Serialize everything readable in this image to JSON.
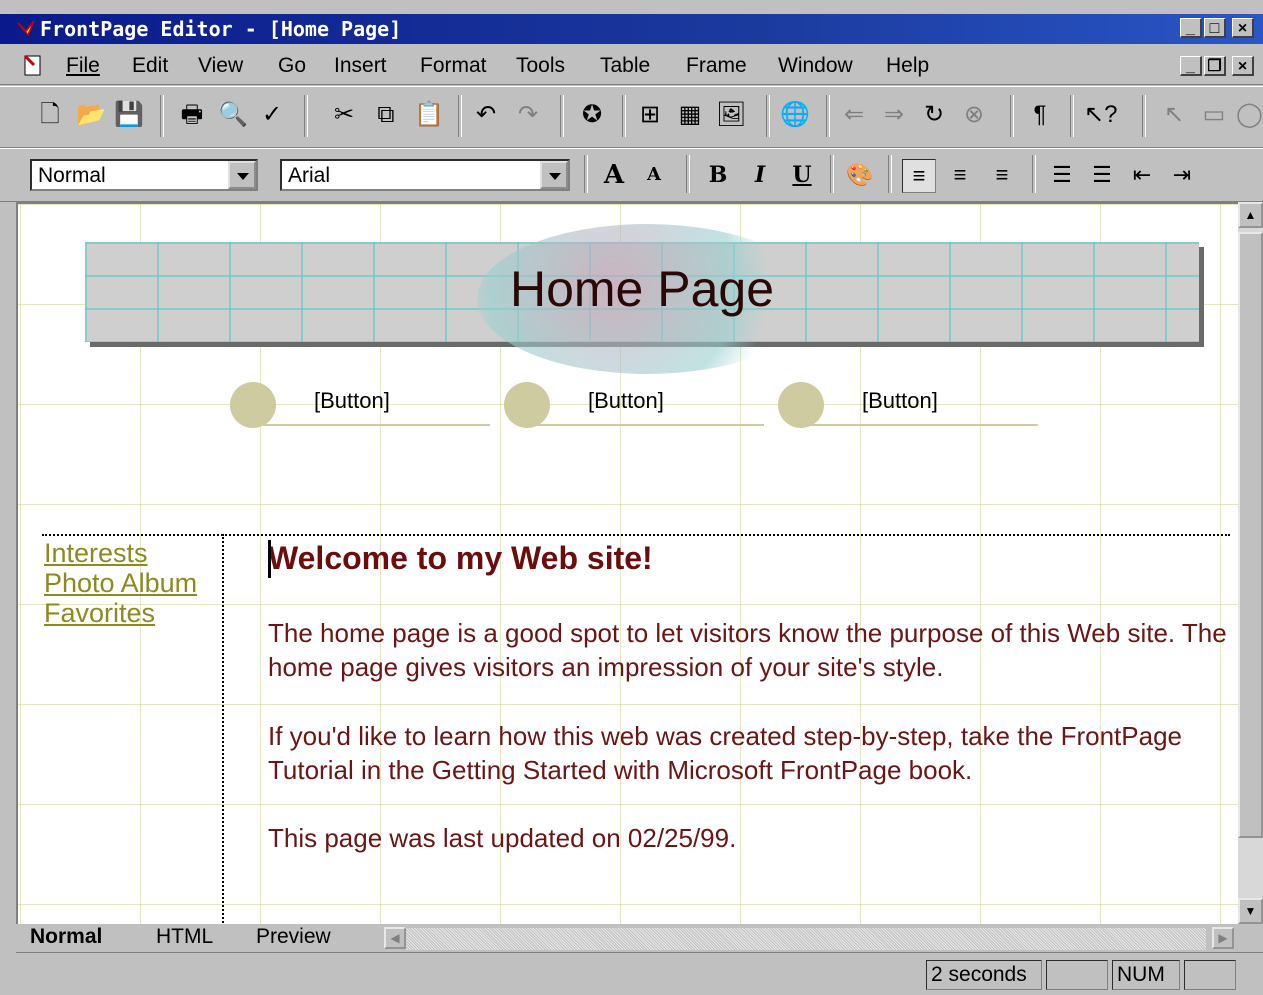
{
  "titlebar": {
    "title": "FrontPage Editor - [Home Page]",
    "buttons": [
      "minimize",
      "maximize",
      "close"
    ]
  },
  "menubar": {
    "items": [
      "File",
      "Edit",
      "View",
      "Go",
      "Insert",
      "Format",
      "Tools",
      "Table",
      "Frame",
      "Window",
      "Help"
    ]
  },
  "toolbar_standard": {
    "icons": [
      "new-icon",
      "open-icon",
      "save-icon",
      "print-icon",
      "print-preview-icon",
      "spelling-icon",
      "cut-icon",
      "copy-icon",
      "paste-icon",
      "undo-icon",
      "redo-icon",
      "webbot-icon",
      "table-icon",
      "insert-table-icon",
      "image-icon",
      "hyperlink-icon",
      "back-icon",
      "forward-icon",
      "refresh-icon",
      "stop-icon",
      "paragraph-marks-icon",
      "help-icon",
      "pointer-icon",
      "rectangle-icon"
    ]
  },
  "toolbar_format": {
    "style_value": "Normal",
    "font_value": "Arial",
    "buttons": [
      "increase-font-icon",
      "decrease-font-icon",
      "bold-icon",
      "italic-icon",
      "underline-icon",
      "text-color-icon",
      "align-left-icon",
      "align-center-icon",
      "align-right-icon",
      "numbered-list-icon",
      "bulleted-list-icon",
      "decrease-indent-icon",
      "increase-indent-icon"
    ]
  },
  "page": {
    "banner_title": "Home Page",
    "nav_buttons": [
      "[Button]",
      "[Button]",
      "[Button]"
    ],
    "side_links": [
      "Interests",
      "Photo Album",
      "Favorites"
    ],
    "heading": "Welcome to my Web site!",
    "paragraphs": [
      "The home page is a good spot to let visitors know the purpose of this Web site. The home page gives visitors an impression of your site's style.",
      "If you'd like to learn how this web was created step-by-step, take the FrontPage Tutorial in the Getting Started with Microsoft FrontPage book.",
      "This page was last updated on 02/25/99."
    ]
  },
  "tabs": [
    "Normal",
    "HTML",
    "Preview"
  ],
  "statusbar": {
    "download_time": "2 seconds",
    "num": "NUM"
  }
}
